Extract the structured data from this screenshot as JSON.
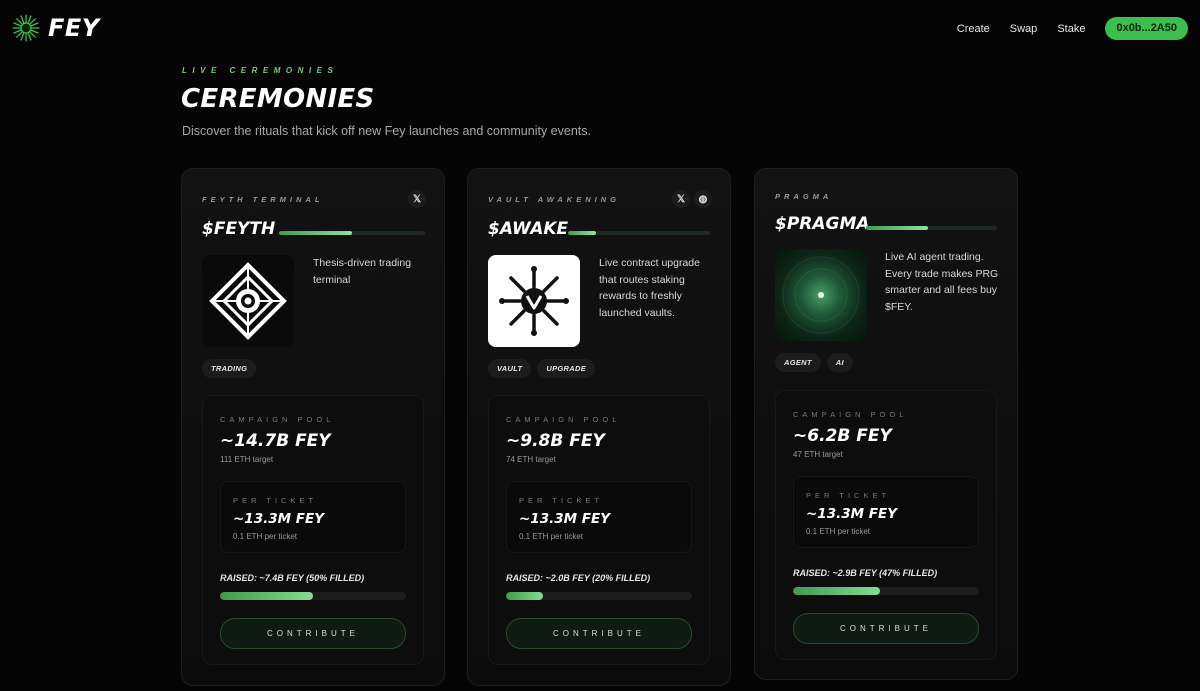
{
  "brand": {
    "name": "FEY",
    "accent": "#3cbf4e"
  },
  "nav": {
    "links": [
      "Create",
      "Swap",
      "Stake"
    ],
    "wallet": "0x0b...2A50"
  },
  "hero": {
    "eyebrow": "LIVE CEREMONIES",
    "title": "CEREMONIES",
    "subtitle": "Discover the rituals that kick off new Fey launches and community events."
  },
  "cards": [
    {
      "label": "FEYTH TERMINAL",
      "ticker": "$FEYTH",
      "ticker_progress": 0.5,
      "socials": [
        "x-icon"
      ],
      "image": "diamond-eye-logo",
      "description": "Thesis-driven trading terminal",
      "tags": [
        "TRADING"
      ],
      "pool_label": "CAMPAIGN POOL",
      "pool_value": "~14.7B FEY",
      "pool_target": "111 ETH target",
      "ticket_label": "PER TICKET",
      "ticket_value": "~13.3M FEY",
      "ticket_sub": "0.1 ETH per ticket",
      "raised": "RAISED: ~7.4B FEY (50% FILLED)",
      "raised_fraction": 0.5,
      "button": "CONTRIBUTE"
    },
    {
      "label": "VAULT AWAKENING",
      "ticker": "$AWAKE",
      "ticker_progress": 0.2,
      "socials": [
        "x-icon",
        "globe-icon"
      ],
      "image": "vault-sigil-logo",
      "description": "Live contract upgrade that routes staking rewards to freshly launched vaults.",
      "tags": [
        "VAULT",
        "UPGRADE"
      ],
      "pool_label": "CAMPAIGN POOL",
      "pool_value": "~9.8B FEY",
      "pool_target": "74 ETH target",
      "ticket_label": "PER TICKET",
      "ticket_value": "~13.3M FEY",
      "ticket_sub": "0.1 ETH per ticket",
      "raised": "RAISED: ~2.0B FEY (20% FILLED)",
      "raised_fraction": 0.2,
      "button": "CONTRIBUTE"
    },
    {
      "label": "PRAGMA",
      "ticker": "$PRAGMA",
      "ticker_progress": 0.47,
      "socials": [],
      "image": "green-orb",
      "description": "Live AI agent trading. Every trade makes PRG smarter and all fees buy $FEY.",
      "tags": [
        "AGENT",
        "AI"
      ],
      "pool_label": "CAMPAIGN POOL",
      "pool_value": "~6.2B FEY",
      "pool_target": "47 ETH target",
      "ticket_label": "PER TICKET",
      "ticket_value": "~13.3M FEY",
      "ticket_sub": "0.1 ETH per ticket",
      "raised": "RAISED: ~2.9B FEY (47% FILLED)",
      "raised_fraction": 0.47,
      "button": "CONTRIBUTE"
    }
  ]
}
